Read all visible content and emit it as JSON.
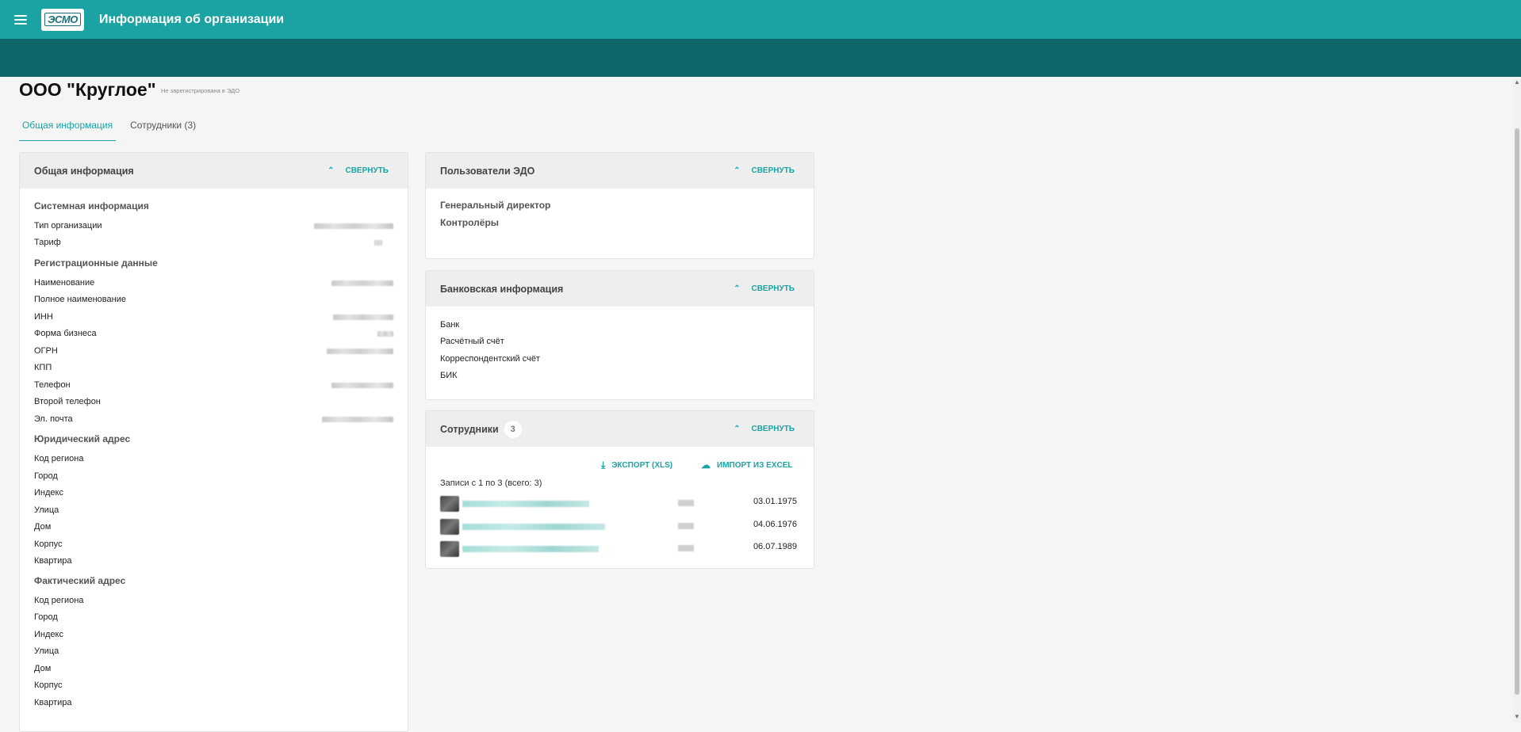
{
  "header": {
    "logo_text": "ЭСМО",
    "title": "Информация об организации",
    "color": "#1ba3a3",
    "sub_color": "#10676a"
  },
  "org": {
    "name": "ООО \"Круглое\"",
    "edo_status": "Не зарегистрирована в ЭДО"
  },
  "tabs": [
    {
      "label": "Общая информация",
      "active": true
    },
    {
      "label": "Сотрудники (3)",
      "active": false
    }
  ],
  "general": {
    "title": "Общая информация",
    "collapse_label": "СВЕРНУТЬ",
    "system_title": "Системная информация",
    "system_rows": [
      "Тип организации",
      "Тариф"
    ],
    "reg_title": "Регистрационные данные",
    "reg_rows": [
      "Наименование",
      "Полное наименование",
      "ИНН",
      "Форма бизнеса",
      "ОГРН",
      "КПП",
      "Телефон",
      "Второй телефон",
      "Эл. почта"
    ],
    "legal_title": "Юридический адрес",
    "legal_rows": [
      "Код региона",
      "Город",
      "Индекс",
      "Улица",
      "Дом",
      "Корпус",
      "Квартира"
    ],
    "actual_title": "Фактический адрес",
    "actual_rows": [
      "Код региона",
      "Город",
      "Индекс",
      "Улица",
      "Дом",
      "Корпус",
      "Квартира"
    ]
  },
  "edo_users": {
    "title": "Пользователи ЭДО",
    "collapse_label": "СВЕРНУТЬ",
    "rows": [
      "Генеральный директор",
      "Контролёры"
    ]
  },
  "bank": {
    "title": "Банковская информация",
    "collapse_label": "СВЕРНУТЬ",
    "rows": [
      "Банк",
      "Расчётный счёт",
      "Корреспондентский счёт",
      "БИК"
    ]
  },
  "employees": {
    "title": "Сотрудники",
    "count": "3",
    "collapse_label": "СВЕРНУТЬ",
    "export_label": "ЭКСПОРТ (XLS)",
    "import_label": "ИМПОРТ ИЗ EXCEL",
    "records_text": "Записи с 1 по 3 (всего: 3)",
    "rows": [
      {
        "date": "03.01.1975"
      },
      {
        "date": "04.06.1976"
      },
      {
        "date": "06.07.1989"
      }
    ]
  },
  "icons": {
    "menu": "hamburger-icon",
    "chevron": "chevron-up-icon",
    "export": "download-icon",
    "import": "cloud-upload-icon"
  }
}
